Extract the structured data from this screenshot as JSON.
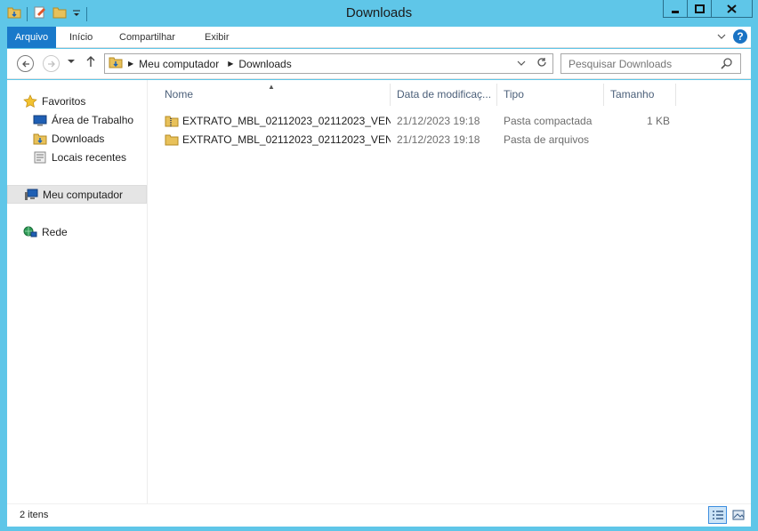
{
  "window": {
    "title": "Downloads",
    "controls": {
      "minimize": "▁",
      "maximize": "□",
      "close": "✕"
    }
  },
  "ribbon": {
    "file_tab": "Arquivo",
    "tabs": [
      "Início",
      "Compartilhar",
      "Exibir"
    ]
  },
  "address": {
    "crumbs": [
      "Meu computador",
      "Downloads"
    ]
  },
  "search": {
    "placeholder": "Pesquisar Downloads"
  },
  "navpane": {
    "favorites": "Favoritos",
    "desktop": "Área de Trabalho",
    "downloads": "Downloads",
    "recent": "Locais recentes",
    "computer": "Meu computador",
    "network": "Rede"
  },
  "columns": {
    "name": "Nome",
    "date": "Data de modificaç...",
    "type": "Tipo",
    "size": "Tamanho"
  },
  "files": [
    {
      "name": "EXTRATO_MBL_02112023_02112023_VEN...",
      "date": "21/12/2023 19:18",
      "type": "Pasta compactada",
      "size": "1 KB",
      "icon": "zip-folder-icon"
    },
    {
      "name": "EXTRATO_MBL_02112023_02112023_VEN...",
      "date": "21/12/2023 19:18",
      "type": "Pasta de arquivos",
      "size": "",
      "icon": "folder-icon"
    }
  ],
  "status": {
    "count": "2 itens"
  },
  "colors": {
    "frame": "#5fc6e8",
    "file_tab": "#1979ca",
    "column_header_text": "#4c607a",
    "selection": "#e5e5e5"
  }
}
